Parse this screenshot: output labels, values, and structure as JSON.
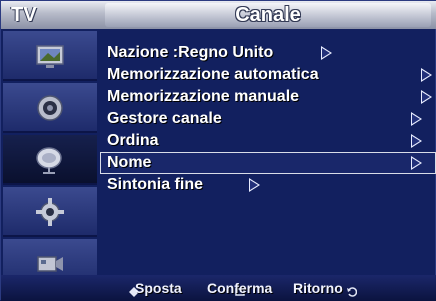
{
  "header": {
    "source_label": "TV",
    "title": "Canale"
  },
  "sidebar": {
    "items": [
      {
        "icon": "picture-icon",
        "active": false
      },
      {
        "icon": "sound-icon",
        "active": false
      },
      {
        "icon": "channel-icon",
        "active": true
      },
      {
        "icon": "setup-icon",
        "active": false
      },
      {
        "icon": "input-icon",
        "active": false
      }
    ]
  },
  "menu": {
    "items": [
      {
        "label": "Nazione  :Regno Unito",
        "has_arrow": true
      },
      {
        "label": "Memorizzazione automatica",
        "has_arrow": true
      },
      {
        "label": "Memorizzazione manuale",
        "has_arrow": true
      },
      {
        "label": "Gestore canale",
        "has_arrow": true
      },
      {
        "label": "Ordina",
        "has_arrow": true
      },
      {
        "label": "Nome",
        "has_arrow": true,
        "selected": true
      },
      {
        "label": "Sintonia fine",
        "has_arrow": true
      }
    ]
  },
  "footer": {
    "move_label": "Sposta",
    "confirm_label": "Conferma",
    "return_label": "Ritorno"
  },
  "colors": {
    "background": "#12205f",
    "header": "#b6bac8",
    "text": "#ffffff"
  }
}
